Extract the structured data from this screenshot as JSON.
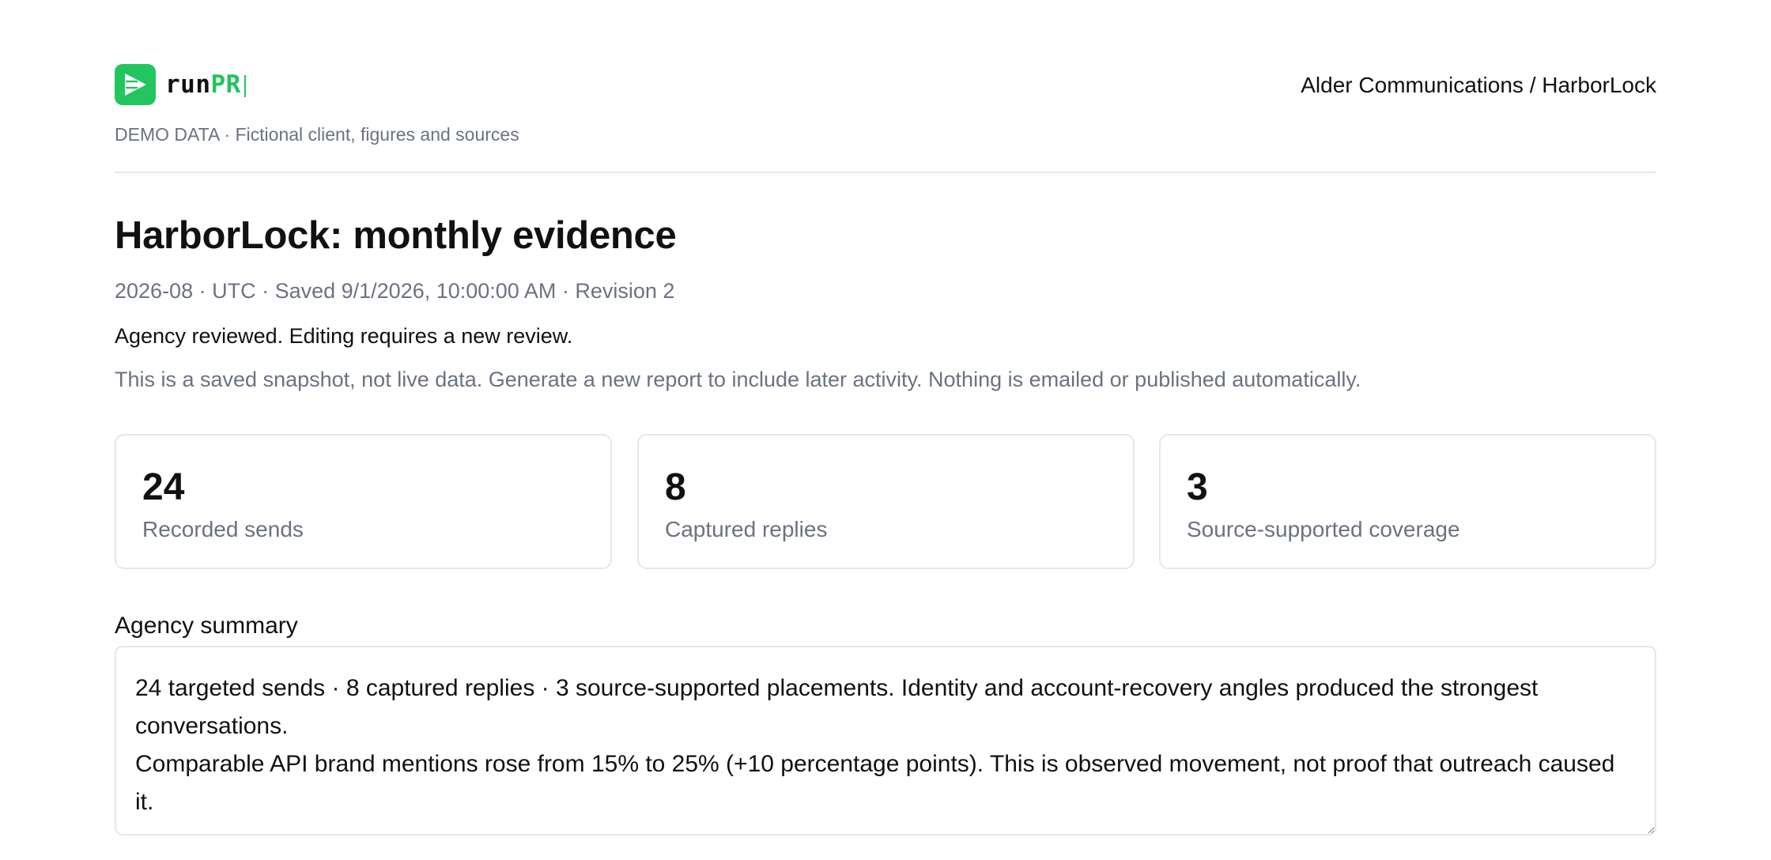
{
  "brand": {
    "name_prefix": "run",
    "name_suffix": "PR",
    "accent_color": "#22c55e",
    "icon": "paper-plane-logo-icon"
  },
  "demo_note": "DEMO DATA · Fictional client, figures and sources",
  "breadcrumb": "Alder Communications / HarborLock",
  "report": {
    "title": "HarborLock: monthly evidence",
    "meta": "2026-08 · UTC · Saved 9/1/2026, 10:00:00 AM · Revision 2",
    "review_status": "Agency reviewed. Editing requires a new review.",
    "disclaimer": "This is a saved snapshot, not live data. Generate a new report to include later activity. Nothing is emailed or published automatically."
  },
  "stats": [
    {
      "value": "24",
      "label": "Recorded sends"
    },
    {
      "value": "8",
      "label": "Captured replies"
    },
    {
      "value": "3",
      "label": "Source-supported coverage"
    }
  ],
  "summary": {
    "label": "Agency summary",
    "text": "24 targeted sends · 8 captured replies · 3 source-supported placements. Identity and account-recovery angles produced the strongest conversations.\nComparable API brand mentions rose from 15% to 25% (+10 percentage points). This is observed movement, not proof that outreach caused it."
  }
}
